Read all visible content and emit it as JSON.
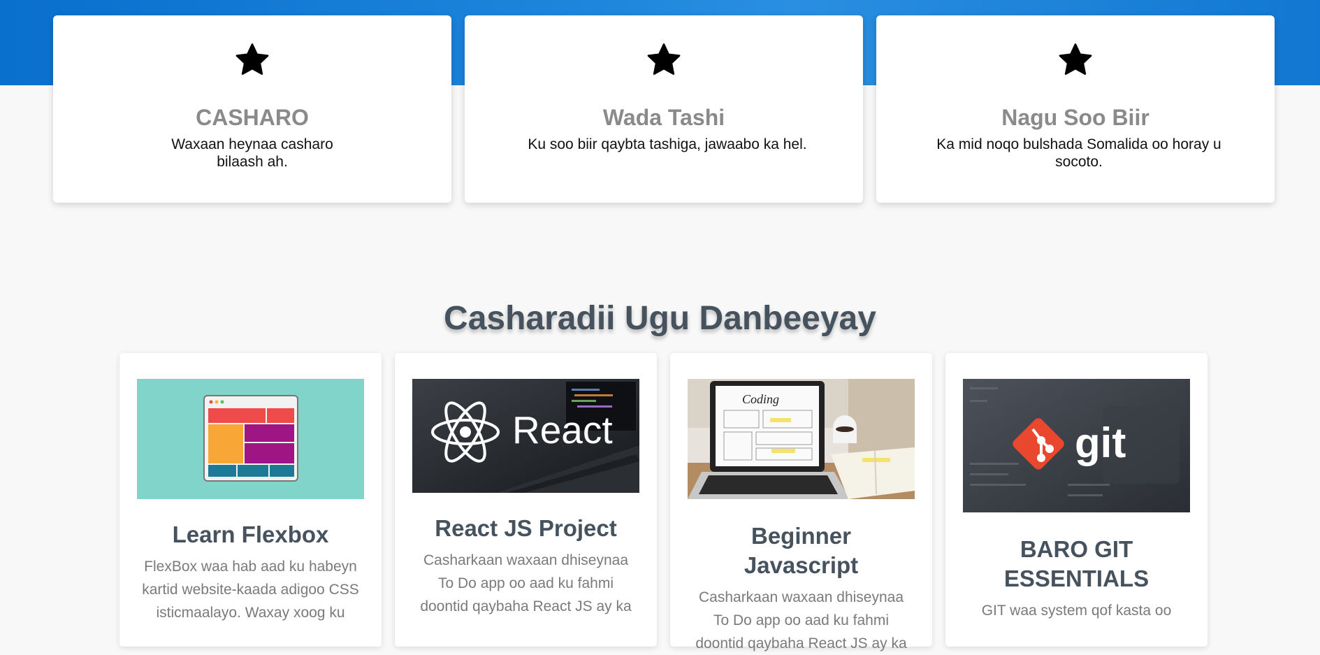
{
  "features": [
    {
      "title": "CASHARO",
      "text": "Waxaan heynaa casharo bilaash ah.",
      "icon": "star-icon"
    },
    {
      "title": "Wada Tashi",
      "text": "Ku soo biir qaybta tashiga, jawaabo ka hel.",
      "icon": "star-icon"
    },
    {
      "title": "Nagu Soo Biir",
      "text": "Ka mid noqo bulshada Somalida oo horay u socoto.",
      "icon": "star-icon"
    }
  ],
  "section_title": "Casharadii Ugu Danbeeyay",
  "courses": [
    {
      "title": "Learn Flexbox",
      "text": "FlexBox waa hab aad ku habeyn kartid website-kaada adigoo CSS isticmaalayo. Waxay xoog ku",
      "image": "flexbox-thumbnail"
    },
    {
      "title": "React JS Project",
      "text": "Casharkaan waxaan dhiseynaa To Do app oo aad ku fahmi doontid qaybaha React JS ay ka",
      "image": "react-thumbnail",
      "image_text": "React"
    },
    {
      "title": "Beginner Javascript",
      "text": "Casharkaan waxaan dhiseynaa To Do app oo aad ku fahmi doontid qaybaha React JS ay ka",
      "image": "coding-laptop-thumbnail",
      "image_text": "Coding"
    },
    {
      "title": "BARO GIT ESSENTIALS",
      "text": "GIT waa system qof kasta oo",
      "image": "git-thumbnail",
      "image_text": "git"
    }
  ],
  "colors": {
    "brand_blue": "#1277d2",
    "title_gray": "#46525e",
    "feature_title": "#8a8a8a"
  }
}
